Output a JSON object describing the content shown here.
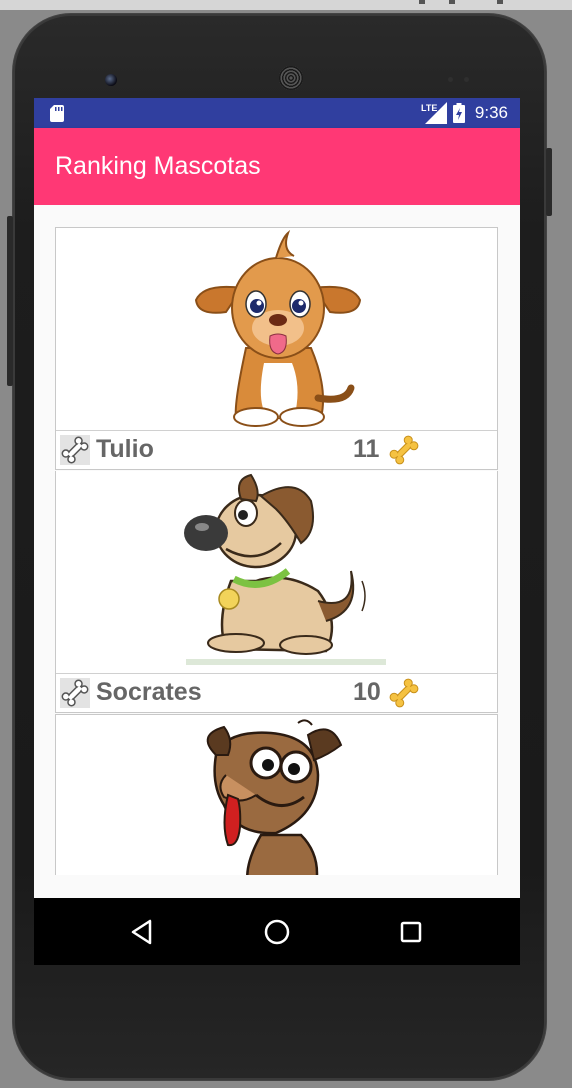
{
  "status_bar": {
    "time": "9:36",
    "network_label": "LTE",
    "icons": [
      "sd-card-icon",
      "signal-icon",
      "battery-icon"
    ]
  },
  "app_bar": {
    "title": "Ranking Mascotas"
  },
  "pets": [
    {
      "name": "Tulio",
      "likes": "11",
      "image_icon": "puppy-illustration"
    },
    {
      "name": "Socrates",
      "likes": "10",
      "image_icon": "dog-with-collar-illustration"
    },
    {
      "name": "",
      "likes": "",
      "image_icon": "brown-dog-illustration"
    }
  ],
  "nav_bar": {
    "icons": [
      "back-icon",
      "home-icon",
      "recents-icon"
    ]
  },
  "colors": {
    "status_bar": "#303f9f",
    "app_bar": "#ff3875",
    "bone_gold": "#f5c242"
  }
}
